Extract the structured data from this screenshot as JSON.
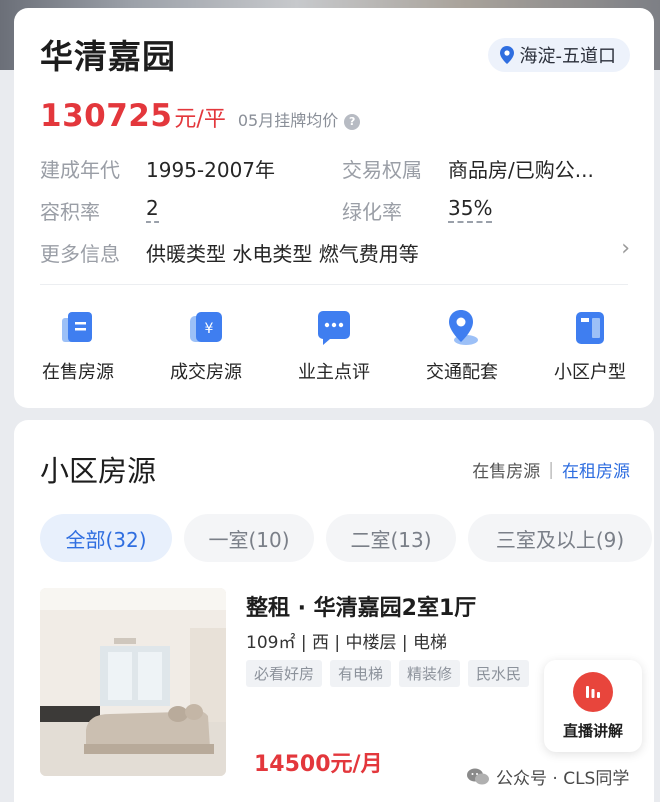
{
  "community": {
    "name": "华清嘉园",
    "location": "海淀-五道口",
    "price_value": "130725",
    "price_unit": "元/平",
    "price_note": "05月挂牌均价"
  },
  "info": {
    "build_year_label": "建成年代",
    "build_year_value": "1995-2007年",
    "ownership_label": "交易权属",
    "ownership_value": "商品房/已购公...",
    "plot_ratio_label": "容积率",
    "plot_ratio_value": "2",
    "green_label": "绿化率",
    "green_value": "35%",
    "more_label": "更多信息",
    "more_value": "供暖类型 水电类型 燃气费用等"
  },
  "quick_actions": [
    {
      "label": "在售房源",
      "icon": "doc-icon"
    },
    {
      "label": "成交房源",
      "icon": "yuan-icon"
    },
    {
      "label": "业主点评",
      "icon": "chat-icon"
    },
    {
      "label": "交通配套",
      "icon": "location-icon"
    },
    {
      "label": "小区户型",
      "icon": "floorplan-icon"
    }
  ],
  "listings_section": {
    "title": "小区房源",
    "link_sale": "在售房源",
    "link_sep": "|",
    "link_rent": "在租房源"
  },
  "filters": [
    "全部(32)",
    "一室(10)",
    "二室(13)",
    "三室及以上(9)"
  ],
  "listing": {
    "title": "整租 · 华清嘉园2室1厅",
    "meta": "109㎡ | 西 | 中楼层 | 电梯",
    "tags": [
      "必看好房",
      "有电梯",
      "精装修",
      "民水民"
    ],
    "price": "14500元/月"
  },
  "live_button": {
    "label": "直播讲解"
  },
  "watermark": "公众号 · CLS同学",
  "colors": {
    "accent_blue": "#2f6ee0",
    "price_red": "#e3373c"
  }
}
